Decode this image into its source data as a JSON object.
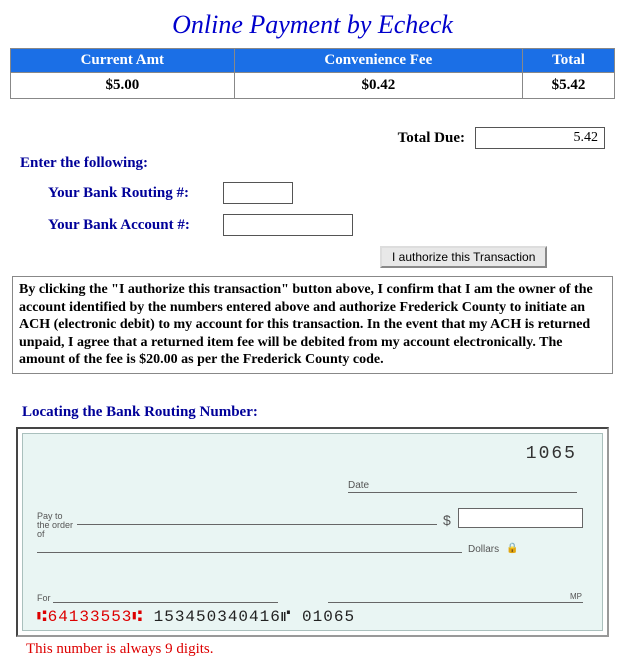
{
  "title": "Online Payment by Echeck",
  "table": {
    "headers": [
      "Current Amt",
      "Convenience Fee",
      "Total"
    ],
    "row": [
      "$5.00",
      "$0.42",
      "$5.42"
    ]
  },
  "total_due_label": "Total Due:",
  "total_due_value": "5.42",
  "enter_following": "Enter the following:",
  "routing_label": "Your Bank Routing #:",
  "account_label": "Your Bank Account #:",
  "authorize_button": "I authorize this Transaction",
  "disclosure": "By clicking the \"I authorize this transaction\" button above, I confirm that I am the owner of the account identified by the numbers entered above and authorize Frederick County to initiate an ACH (electronic debit) to my account for this transaction. In the event that my ACH is returned unpaid, I agree that a returned item fee will be debited from my account electronically. The amount of the fee is $20.00 as per the Frederick County code.",
  "locating_label": "Locating the Bank Routing Number:",
  "check": {
    "number": "1065",
    "date_label": "Date",
    "payto_label": "Pay to the order of",
    "dollars_label": "Dollars",
    "for_label": "For",
    "mp_label": "MP",
    "micr_routing": "⑆64133553⑆",
    "micr_rest": " 153450340416⑈  01065"
  },
  "routing_note": "This number is always 9 digits."
}
